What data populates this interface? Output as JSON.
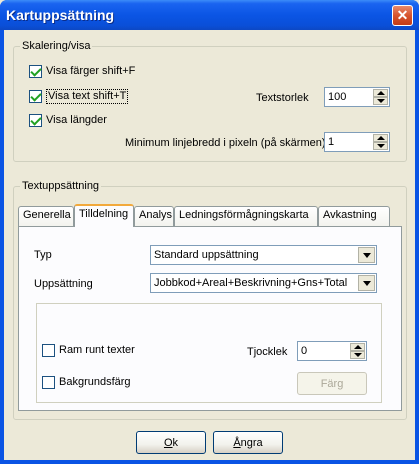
{
  "window": {
    "title": "Kartuppsättning"
  },
  "scaling_group": {
    "legend": "Skalering/visa",
    "show_colors": {
      "label": "Visa färger  shift+F",
      "checked": true
    },
    "show_text": {
      "label": "Visa text  shift+T",
      "checked": true
    },
    "show_lengths": {
      "label": "Visa längder",
      "checked": true
    },
    "text_size": {
      "label": "Textstorlek",
      "value": "100"
    },
    "min_line_width": {
      "label": "Minimum linjebredd i pixeln (på skärmen)",
      "value": "1"
    }
  },
  "text_group": {
    "legend": "Textuppsättning",
    "tabs": [
      {
        "label": "Generella",
        "active": false
      },
      {
        "label": "Tilldelning",
        "active": true
      },
      {
        "label": "Analys",
        "active": false
      },
      {
        "label": "Ledningsförmågningskarta",
        "active": false
      },
      {
        "label": "Avkastning",
        "active": false
      }
    ],
    "type_row": {
      "label": "Typ",
      "value": "Standard uppsättning"
    },
    "setup_row": {
      "label": "Uppsättning",
      "value": "Jobbkod+Areal+Beskrivning+Gns+Total"
    },
    "frame_text": {
      "label": "Ram runt texter",
      "checked": false
    },
    "thickness": {
      "label": "Tjocklek",
      "value": "0"
    },
    "background": {
      "label": "Bakgrundsfärg",
      "checked": false
    },
    "color_button": {
      "label": "Färg"
    }
  },
  "footer": {
    "ok": {
      "accel": "O",
      "rest": "k"
    },
    "cancel": {
      "accel": "Å",
      "rest": "ngra"
    }
  },
  "colors": {
    "titlebar": "#0b55e5",
    "dialog_bg": "#ece9d8",
    "active_tab_accent": "#f2a93b",
    "checkmark": "#21a121"
  }
}
